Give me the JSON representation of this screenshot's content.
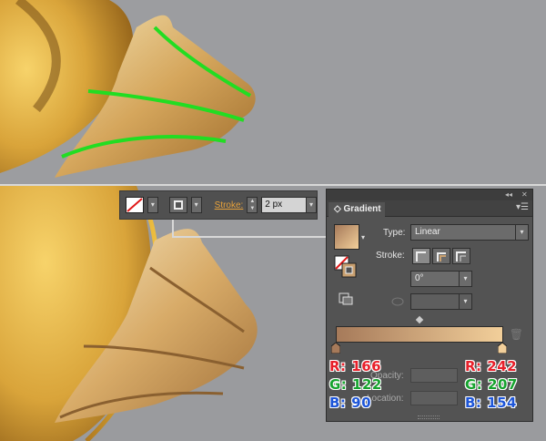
{
  "toolbar": {
    "stroke_label": "Stroke:",
    "stroke_value": "2 px",
    "fill_dd": "▾",
    "stroke_dd": "▾",
    "spin_up": "▲",
    "spin_down": "▼",
    "value_dd": "▾"
  },
  "panel": {
    "collapse": "◂◂",
    "close": "✕",
    "tab": "Gradient",
    "tab_icon": "◇",
    "menu": "▾☰",
    "type_label": "Type:",
    "type_value": "Linear",
    "stroke_label": "Stroke:",
    "angle_value": "0°",
    "select_arrow": "▾",
    "opacity_label": "Opacity:",
    "location_label": "Location:",
    "trash": "🗑"
  },
  "colors": {
    "left_stop": "#a67a5a",
    "right_stop": "#f2cf9a",
    "highlight_stroke": "#22dd22",
    "accent_label": "#e8a23a"
  },
  "annotations": {
    "left": {
      "r": "R: 166",
      "g": "G: 122",
      "b": "B: 90"
    },
    "right": {
      "r": "R: 242",
      "g": "G: 207",
      "b": "B: 154"
    }
  }
}
